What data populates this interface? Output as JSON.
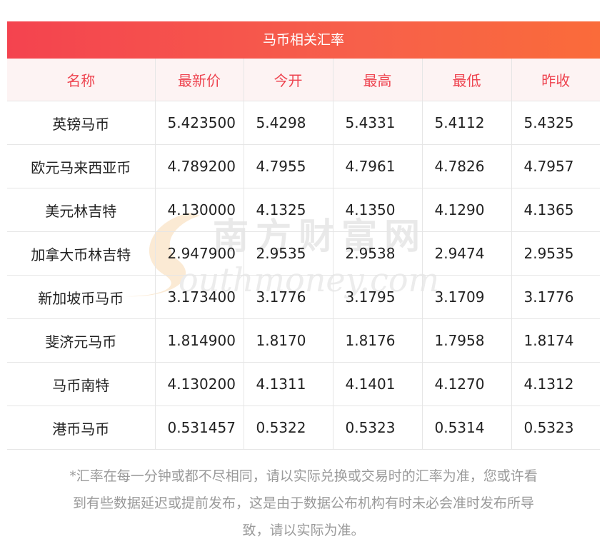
{
  "table": {
    "title": "马币相关汇率",
    "headers": [
      "名称",
      "最新价",
      "今开",
      "最高",
      "最低",
      "昨收"
    ],
    "rows": [
      {
        "name": "英镑马币",
        "latest": "5.423500",
        "open": "5.4298",
        "high": "5.4331",
        "low": "5.4112",
        "prev_close": "5.4325"
      },
      {
        "name": "欧元马来西亚币",
        "latest": "4.789200",
        "open": "4.7955",
        "high": "4.7961",
        "low": "4.7826",
        "prev_close": "4.7957"
      },
      {
        "name": "美元林吉特",
        "latest": "4.130000",
        "open": "4.1325",
        "high": "4.1350",
        "low": "4.1290",
        "prev_close": "4.1365"
      },
      {
        "name": "加拿大币林吉特",
        "latest": "2.947900",
        "open": "2.9535",
        "high": "2.9538",
        "low": "2.9474",
        "prev_close": "2.9535"
      },
      {
        "name": "新加坡币马币",
        "latest": "3.173400",
        "open": "3.1776",
        "high": "3.1795",
        "low": "3.1709",
        "prev_close": "3.1776"
      },
      {
        "name": "斐济元马币",
        "latest": "1.814900",
        "open": "1.8170",
        "high": "1.8176",
        "low": "1.7958",
        "prev_close": "1.8174"
      },
      {
        "name": "马币南特",
        "latest": "4.130200",
        "open": "4.1311",
        "high": "4.1401",
        "low": "4.1270",
        "prev_close": "4.1312"
      },
      {
        "name": "港币马币",
        "latest": "0.531457",
        "open": "0.5322",
        "high": "0.5323",
        "low": "0.5314",
        "prev_close": "0.5323"
      }
    ]
  },
  "watermark": {
    "line1": "南方财富网",
    "line2": "outhmoney.com"
  },
  "note": {
    "line1": "*汇率在每一分钟或都不尽相同，请以实际兑换或交易时的汇率为准，您或许看",
    "line2": "到有些数据延迟或提前发布，这是由于数据公布机构有时未必会准时发布所导",
    "line3": "致，请以实际为准。"
  },
  "colors": {
    "header_text": "#ee4450",
    "title_gradient_start": "#f4434f",
    "title_gradient_end": "#fa6b3a",
    "note_text": "#9a9a9a"
  }
}
